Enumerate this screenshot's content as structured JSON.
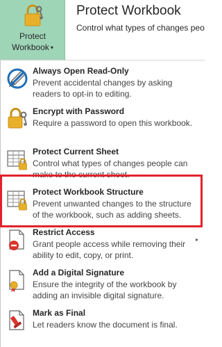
{
  "button": {
    "label_line1": "Protect",
    "label_line2": "Workbook",
    "caret": "▾",
    "icon": "lock-key-icon"
  },
  "header": {
    "title": "Protect Workbook",
    "subtitle": "Control what types of changes peo"
  },
  "menu": {
    "items": [
      {
        "title": "Always Open Read-Only",
        "desc": "Prevent accidental changes by asking readers to opt-in to editing.",
        "icon": "pencil-no-edit-icon"
      },
      {
        "title": "Encrypt with Password",
        "desc": "Require a password to open this workbook.",
        "icon": "lock-key-icon"
      },
      {
        "title": "Protect Current Sheet",
        "desc": "Control what types of changes people can make to the current sheet.",
        "icon": "sheet-lock-icon"
      },
      {
        "title": "Protect Workbook Structure",
        "desc": "Prevent unwanted changes to the structure of the workbook, such as adding sheets.",
        "icon": "workbook-lock-icon"
      },
      {
        "title": "Restrict Access",
        "desc": "Grant people access while removing their ability to edit, copy, or print.",
        "icon": "restrict-document-icon",
        "submenu_arrow": "▸"
      },
      {
        "title": "Add a Digital Signature",
        "desc": "Ensure the integrity of the workbook by adding an invisible digital signature.",
        "icon": "signature-ribbon-icon"
      },
      {
        "title": "Mark as Final",
        "desc": "Let readers know the document is final.",
        "icon": "final-stamp-icon"
      }
    ]
  },
  "colors": {
    "button_bg": "#9fd5b7",
    "highlight_border": "#e3212a",
    "lock_gold": "#e8b02a"
  }
}
